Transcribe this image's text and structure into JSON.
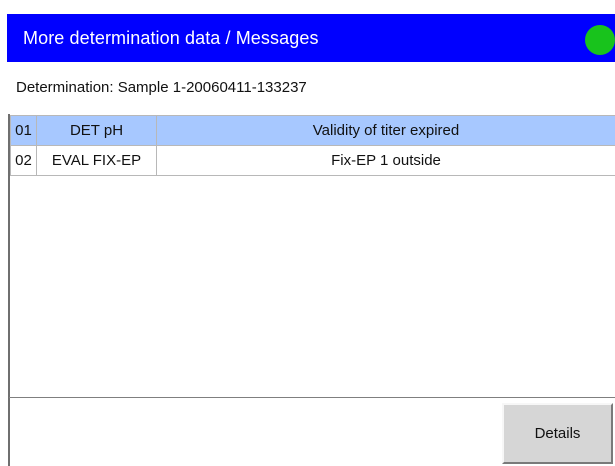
{
  "window": {
    "title": "More determination data / Messages"
  },
  "status_indicator": {
    "color": "#18c31c"
  },
  "determination": {
    "label": "Determination: Sample 1-20060411-133237"
  },
  "messages": [
    {
      "number": "01",
      "code": "DET pH",
      "text": "Validity of titer expired",
      "selected": true
    },
    {
      "number": "02",
      "code": "EVAL FIX-EP",
      "text": "Fix-EP 1 outside",
      "selected": false
    }
  ],
  "footer": {
    "details_label": "Details"
  },
  "colors": {
    "titlebar": "#0000ff",
    "selection": "#a7c8ff"
  }
}
